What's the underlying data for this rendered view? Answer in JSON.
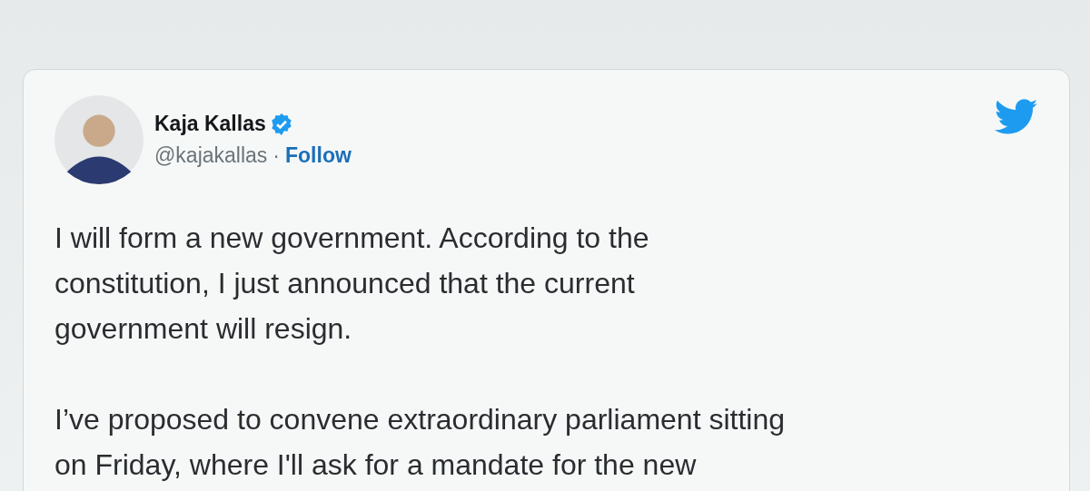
{
  "tweet": {
    "author": {
      "name": "Kaja Kallas",
      "verified": true,
      "handle": "@kajakallas",
      "separator": "·",
      "follow": "Follow"
    },
    "paragraphs": [
      {
        "lines": [
          "I will form a new government. According to the",
          "constitution, I just announced that the current",
          "government will resign."
        ]
      },
      {
        "lines": [
          "I’ve proposed to convene extraordinary parliament sitting",
          "on Friday, where I'll ask for a mandate for the new"
        ]
      }
    ]
  }
}
